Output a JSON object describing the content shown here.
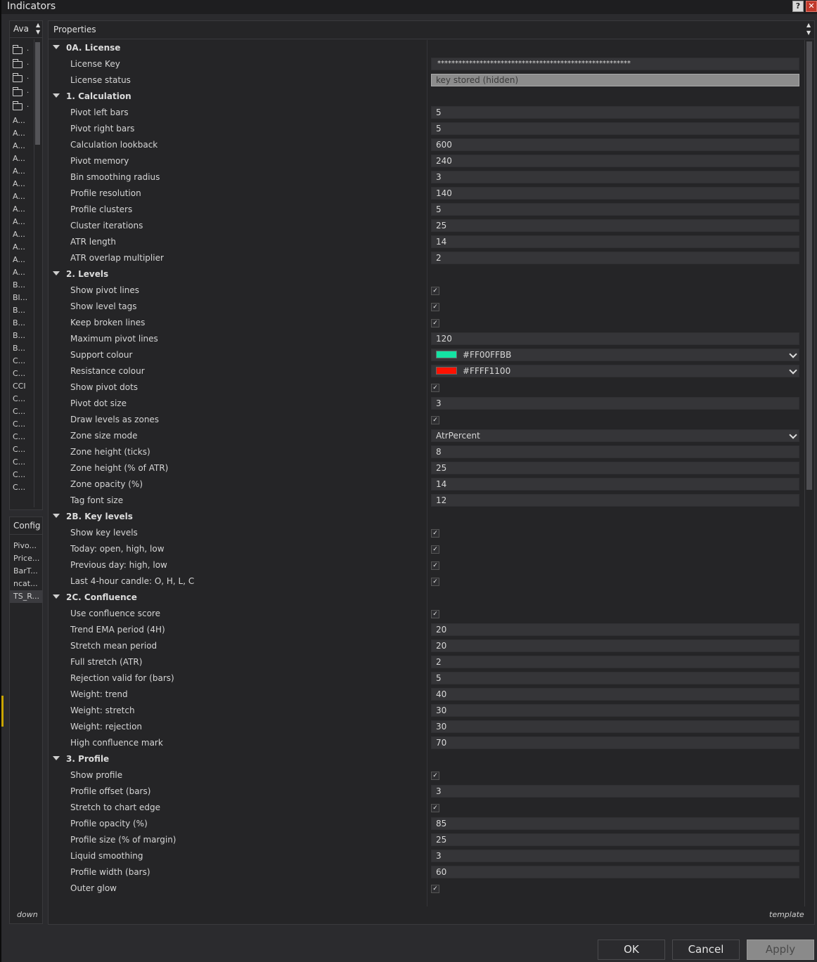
{
  "window": {
    "title": "Indicators",
    "help_label": "?",
    "close_label": "✕"
  },
  "available": {
    "label": "Avai",
    "folder_count": 5,
    "items": [
      "A...",
      "A...",
      "A...",
      "A...",
      "A...",
      "A...",
      "A...",
      "A...",
      "A...",
      "A...",
      "A...",
      "A...",
      "A...",
      "B...",
      "Bl...",
      "B...",
      "B...",
      "B...",
      "B...",
      "C...",
      "C...",
      "CCI",
      "C...",
      "C...",
      "C...",
      "C...",
      "C...",
      "C...",
      "C...",
      "C..."
    ]
  },
  "configured": {
    "label": "Config",
    "items": [
      "Pivo...",
      "Price...",
      "BarT...",
      "ncat...",
      "TS_R..."
    ],
    "selected_index": 4,
    "footer": "down"
  },
  "properties": {
    "title": "Properties",
    "footer": "template",
    "rows": [
      {
        "type": "cat",
        "label": "0A. License"
      },
      {
        "type": "text",
        "label": "License Key",
        "value": "*******************************************************"
      },
      {
        "type": "readonly",
        "label": "License status",
        "value": "key stored (hidden)"
      },
      {
        "type": "cat",
        "label": "1. Calculation"
      },
      {
        "type": "text",
        "label": "Pivot left bars",
        "value": "5"
      },
      {
        "type": "text",
        "label": "Pivot right bars",
        "value": "5"
      },
      {
        "type": "text",
        "label": "Calculation lookback",
        "value": "600"
      },
      {
        "type": "text",
        "label": "Pivot memory",
        "value": "240"
      },
      {
        "type": "text",
        "label": "Bin smoothing radius",
        "value": "3"
      },
      {
        "type": "text",
        "label": "Profile resolution",
        "value": "140"
      },
      {
        "type": "text",
        "label": "Profile clusters",
        "value": "5"
      },
      {
        "type": "text",
        "label": "Cluster iterations",
        "value": "25"
      },
      {
        "type": "text",
        "label": "ATR length",
        "value": "14"
      },
      {
        "type": "text",
        "label": "ATR overlap multiplier",
        "value": "2"
      },
      {
        "type": "cat",
        "label": "2. Levels"
      },
      {
        "type": "check",
        "label": "Show pivot lines",
        "value": "✓"
      },
      {
        "type": "check",
        "label": "Show level tags",
        "value": "✓"
      },
      {
        "type": "check",
        "label": "Keep broken lines",
        "value": "✓"
      },
      {
        "type": "text",
        "label": "Maximum pivot lines",
        "value": "120"
      },
      {
        "type": "color",
        "label": "Support colour",
        "value": "#FF00FFBB",
        "swatch": "#14e3a3"
      },
      {
        "type": "color",
        "label": "Resistance colour",
        "value": "#FFFF1100",
        "swatch": "#ff1100"
      },
      {
        "type": "check",
        "label": "Show pivot dots",
        "value": "✓"
      },
      {
        "type": "text",
        "label": "Pivot dot size",
        "value": "3"
      },
      {
        "type": "check",
        "label": "Draw levels as zones",
        "value": "✓"
      },
      {
        "type": "select",
        "label": "Zone size mode",
        "value": "AtrPercent"
      },
      {
        "type": "text",
        "label": "Zone height (ticks)",
        "value": "8"
      },
      {
        "type": "text",
        "label": "Zone height (% of ATR)",
        "value": "25"
      },
      {
        "type": "text",
        "label": "Zone opacity (%)",
        "value": "14"
      },
      {
        "type": "text",
        "label": "Tag font size",
        "value": "12"
      },
      {
        "type": "cat",
        "label": "2B. Key levels"
      },
      {
        "type": "check",
        "label": "Show key levels",
        "value": "✓"
      },
      {
        "type": "check",
        "label": "Today: open, high, low",
        "value": "✓"
      },
      {
        "type": "check",
        "label": "Previous day: high, low",
        "value": "✓"
      },
      {
        "type": "check",
        "label": "Last 4-hour candle: O, H, L, C",
        "value": "✓"
      },
      {
        "type": "cat",
        "label": "2C. Confluence"
      },
      {
        "type": "check",
        "label": "Use confluence score",
        "value": "✓"
      },
      {
        "type": "text",
        "label": "Trend EMA period (4H)",
        "value": "20"
      },
      {
        "type": "text",
        "label": "Stretch mean period",
        "value": "20"
      },
      {
        "type": "text",
        "label": "Full stretch (ATR)",
        "value": "2"
      },
      {
        "type": "text",
        "label": "Rejection valid for (bars)",
        "value": "5"
      },
      {
        "type": "text",
        "label": "Weight: trend",
        "value": "40"
      },
      {
        "type": "text",
        "label": "Weight: stretch",
        "value": "30"
      },
      {
        "type": "text",
        "label": "Weight: rejection",
        "value": "30"
      },
      {
        "type": "text",
        "label": "High confluence mark",
        "value": "70"
      },
      {
        "type": "cat",
        "label": "3. Profile"
      },
      {
        "type": "check",
        "label": "Show profile",
        "value": "✓"
      },
      {
        "type": "text",
        "label": "Profile offset (bars)",
        "value": "3"
      },
      {
        "type": "check",
        "label": "Stretch to chart edge",
        "value": "✓"
      },
      {
        "type": "text",
        "label": "Profile opacity (%)",
        "value": "85"
      },
      {
        "type": "text",
        "label": "Profile size (% of margin)",
        "value": "25"
      },
      {
        "type": "text",
        "label": "Liquid smoothing",
        "value": "3"
      },
      {
        "type": "text",
        "label": "Profile width (bars)",
        "value": "60"
      },
      {
        "type": "check",
        "label": "Outer glow",
        "value": "✓"
      }
    ]
  },
  "buttons": {
    "ok": "OK",
    "cancel": "Cancel",
    "apply": "Apply"
  }
}
